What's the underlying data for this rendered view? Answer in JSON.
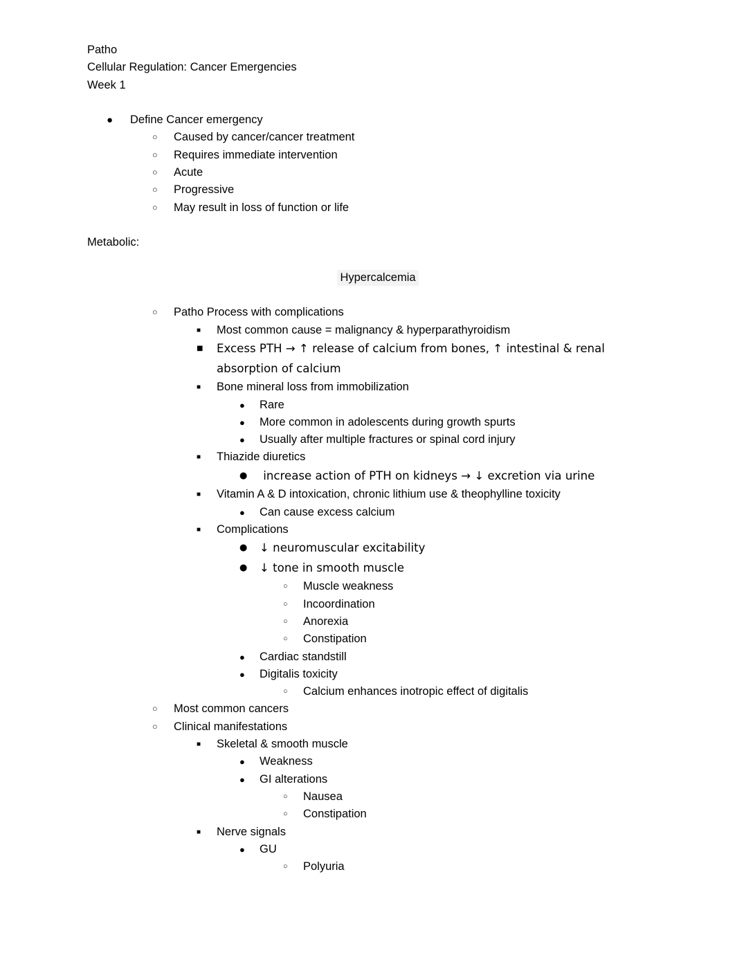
{
  "document": {
    "title_lines": [
      "Patho",
      "Cellular Regulation: Cancer Emergencies",
      "Week 1"
    ],
    "section_label": "Metabolic:",
    "highlighted_term": "Hypercalcemia",
    "highlight_color": "#f3f3f3",
    "text_color": "#000000",
    "page_background": "#ffffff"
  },
  "markers": {
    "level1": "●",
    "level2": "○",
    "level3": "■",
    "level4": "●",
    "level5": "○"
  },
  "outline": {
    "define_cancer_emergency": {
      "label": "Define Cancer emergency",
      "children": [
        "Caused by cancer/cancer treatment",
        "Requires immediate intervention",
        "Acute",
        "Progressive",
        "May result in loss of function or life"
      ]
    },
    "hypercalcemia": {
      "patho_process": {
        "label": "Patho Process with complications",
        "items": {
          "most_common_cause": "Most common cause = malignancy & hyperparathyroidism",
          "excess_pth": "Excess PTH → ↑ release of calcium from bones, ↑ intestinal & renal absorption of calcium",
          "bone_mineral_loss": {
            "label": "Bone mineral loss from immobilization",
            "children": [
              "Rare",
              "More common in adolescents during growth spurts",
              "Usually after multiple fractures or spinal cord injury"
            ]
          },
          "thiazide_diuretics": {
            "label": "Thiazide diuretics",
            "children": [
              " increase action of PTH on kidneys → ↓ excretion via urine"
            ]
          },
          "vitamin_intoxication": {
            "label": "Vitamin A & D intoxication, chronic lithium use & theophylline toxicity",
            "children": [
              "Can cause excess calcium"
            ]
          },
          "complications": {
            "label": "Complications",
            "neuromuscular": "↓ neuromuscular excitability",
            "smooth_muscle_tone": "↓ tone in smooth muscle",
            "smooth_muscle_children": [
              "Muscle weakness",
              "Incoordination",
              "Anorexia",
              "Constipation"
            ],
            "cardiac_standstill": "Cardiac standstill",
            "digitalis_toxicity": "Digitalis toxicity",
            "digitalis_children": [
              "Calcium enhances inotropic effect of digitalis"
            ]
          }
        }
      },
      "most_common_cancers": "Most common cancers",
      "clinical_manifestations": {
        "label": "Clinical manifestations",
        "skeletal_smooth_muscle": {
          "label": "Skeletal & smooth muscle",
          "weakness": "Weakness",
          "gi_alterations": "GI alterations",
          "gi_children": [
            "Nausea",
            "Constipation"
          ]
        },
        "nerve_signals": {
          "label": "Nerve signals",
          "gu": "GU",
          "gu_children": [
            "Polyuria"
          ]
        }
      }
    }
  }
}
